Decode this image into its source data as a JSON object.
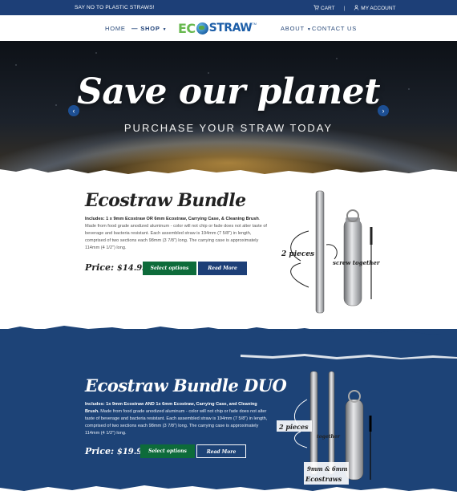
{
  "topbar": {
    "promo": "SAY NO TO PLASTIC STRAWS!",
    "cart": "CART",
    "account": "MY ACCOUNT",
    "separator": "|"
  },
  "nav": {
    "home": "HOME",
    "shop": "SHOP",
    "about": "ABOUT",
    "contact": "CONTACT US"
  },
  "logo": {
    "part1": "EC",
    "part2": "STRAW",
    "tm": "TM"
  },
  "hero": {
    "title": "Save our planet",
    "subtitle": "PURCHASE YOUR STRAW TODAY",
    "prev_icon": "chevron-left-icon",
    "next_icon": "chevron-right-icon"
  },
  "product1": {
    "title": "Ecostraw Bundle",
    "includes_label": "Includes: 1 x 9mm Ecostraw OR 6mm Ecostraw, Carrying Case, & Cleaning Brush",
    "description": ". Made from food grade anodized aluminum - color will not chip or fade does not alter taste of beverage and bacteria resistant.  Each assembled straw is 194mm (7 5/8”) in length, comprised of two sections each 98mm (3 7/8”) long. The carrying case is approximately 114mm (4 1/2”) long.",
    "price_label": "Price:",
    "price": "$14.99",
    "select_button": "Select options",
    "read_button": "Read More",
    "note_pieces": "2 pieces",
    "note_screw": "screw together"
  },
  "product2": {
    "title": "Ecostraw Bundle DUO",
    "includes_label": "Includes: 1x 9mm Ecostraw AND 1x 6mm Ecostraw, Carrying Case, and Cleaning Brush.",
    "description": " Made from food grade anodized aluminum - color will not chip or fade does not alter taste of beverage and bacteria resistant.  Each assembled straw is 194mm (7 5/8”) in length, comprised of two sections each 98mm (3 7/8”) long. The carrying case is approximately 114mm (4 1/2”) long.",
    "price_label": "Price:",
    "price": "$19.99",
    "select_button": "Select options",
    "read_button": "Read More",
    "note_pieces": "2 pieces",
    "note_together": "together",
    "note_sizes": "9mm & 6mm",
    "note_brand": "Ecostraws"
  },
  "colors": {
    "brand_blue": "#1d3f77",
    "brand_green": "#0d6b3a",
    "logo_green": "#67b84e"
  }
}
